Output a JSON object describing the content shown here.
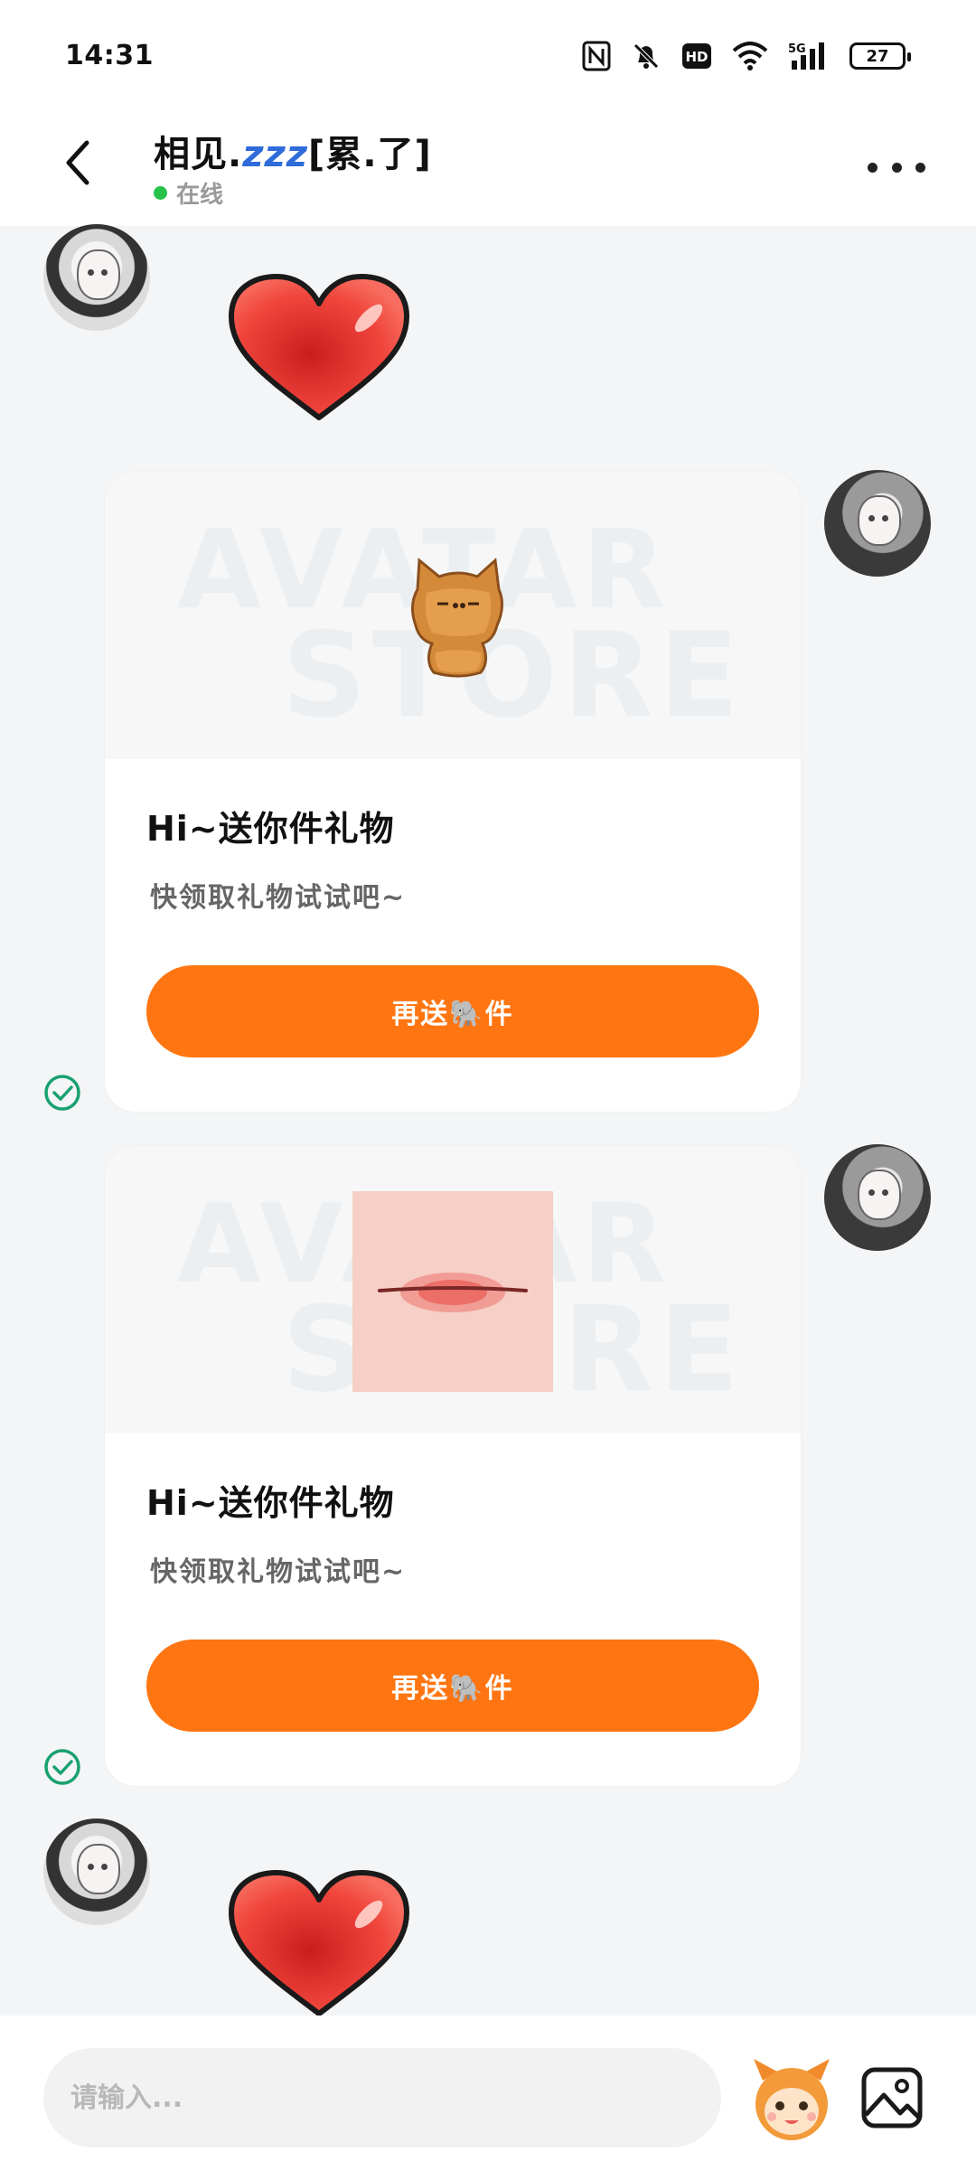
{
  "status_bar": {
    "time": "14:31",
    "battery": "27",
    "network": "5G",
    "hd": "HD"
  },
  "header": {
    "title": "相见.",
    "title_zzz": "zzz",
    "title_suffix": "[累.了]",
    "status": "在线"
  },
  "messages": [
    {
      "type": "sticker",
      "side": "left",
      "sticker": "heart-icon"
    },
    {
      "type": "gift",
      "side": "right",
      "gift": "cookie-cat-gift",
      "title": "Hi~送你件礼物",
      "subtitle": "快领取礼物试试吧~",
      "button_label": "再送🐘件",
      "status": "sent"
    },
    {
      "type": "gift",
      "side": "right",
      "gift": "lips-gift",
      "title": "Hi~送你件礼物",
      "subtitle": "快领取礼物试试吧~",
      "button_label": "再送🐘件",
      "status": "sent"
    },
    {
      "type": "sticker",
      "side": "left",
      "sticker": "heart-icon"
    }
  ],
  "watermark": {
    "line1": "AVATAR",
    "line2": "STORE"
  },
  "input": {
    "placeholder": "请输入..."
  },
  "colors": {
    "accent": "#ff7511",
    "online": "#27c24c",
    "sent_check": "#1aa16f",
    "background": "#f4f5f7"
  }
}
